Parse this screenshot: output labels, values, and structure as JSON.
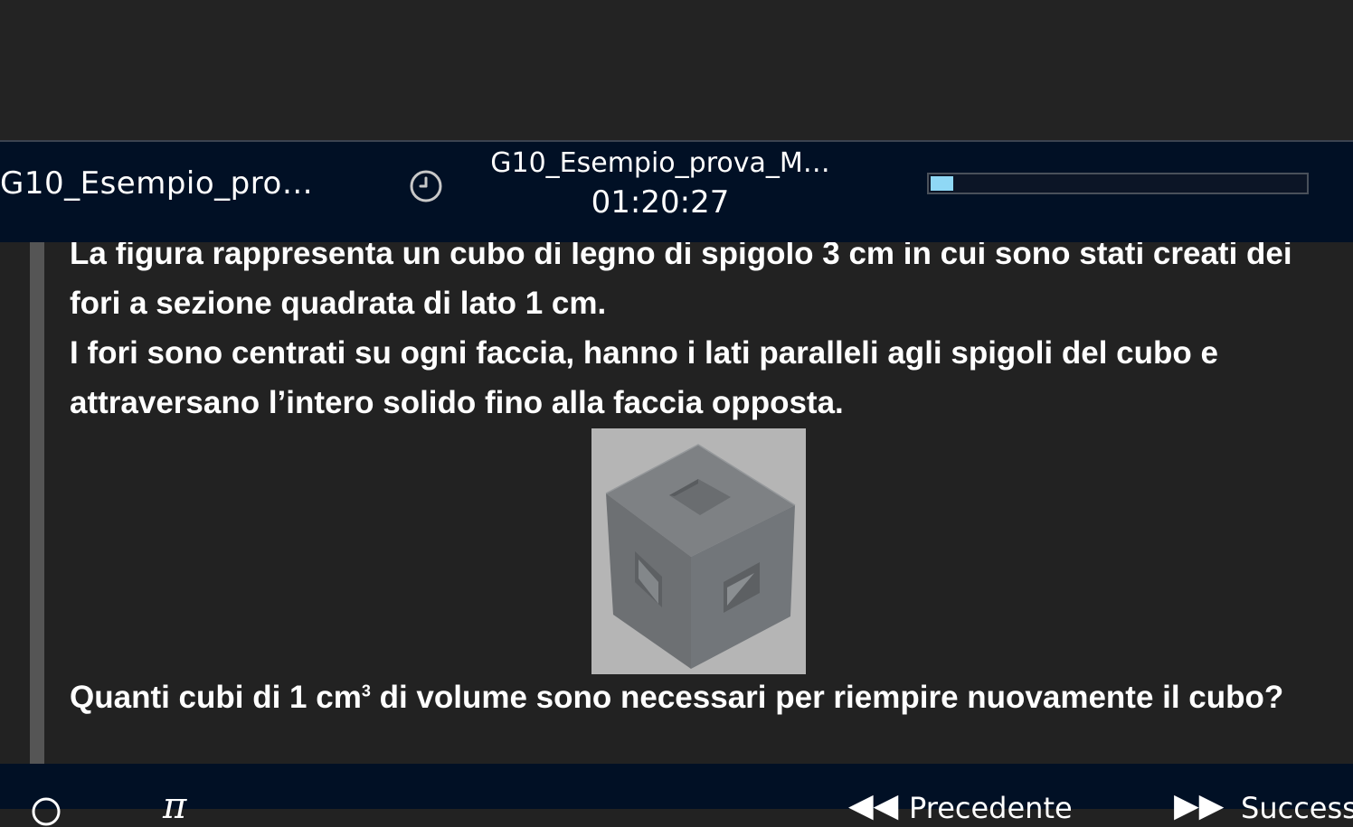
{
  "header": {
    "test_name_short": "G10_Esempio_pro…",
    "test_name_center": "G10_Esempio_prova_M…",
    "timer": "01:20:27",
    "progress_fraction": 0.06,
    "icons": {
      "timer": "clock-icon"
    }
  },
  "question": {
    "paragraph1": "La figura rappresenta  un cubo di legno di spigolo 3 cm in cui sono stati creati dei fori a sezione quadrata di lato 1 cm.",
    "paragraph2": "I fori sono centrati su ogni faccia, hanno i lati paralleli agli spigoli del cubo e attraversano l’intero solido fino alla faccia opposta.",
    "question_before_sup": "Quanti cubi di 1 cm",
    "question_sup": "3",
    "question_after_sup": " di volume sono necessari per riempire nuovamente il cubo?"
  },
  "footer": {
    "previous_label": "Precedente",
    "next_label": "Successivo",
    "icons": {
      "info": "info-icon",
      "math": "pi-icon",
      "previous": "rewind-icon",
      "next": "fast-forward-icon"
    }
  },
  "colors": {
    "header_bg": "#011025",
    "page_bg": "#222222",
    "progress_fill": "#8fd8f5"
  }
}
